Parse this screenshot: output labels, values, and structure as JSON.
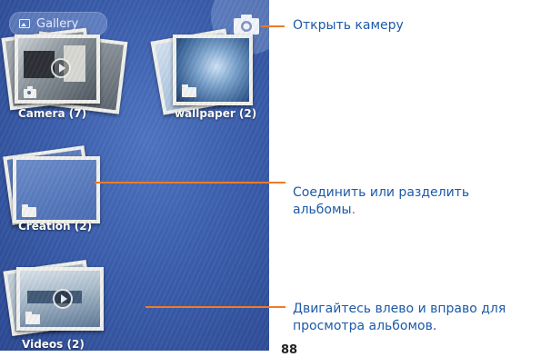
{
  "gallery": {
    "title": "Gallery"
  },
  "albums": [
    {
      "name": "Camera (7)"
    },
    {
      "name": "wallpaper (2)"
    },
    {
      "name": "Creation (2)"
    },
    {
      "name": "Videos (2)"
    }
  ],
  "callouts": {
    "camera": "Открыть камеру",
    "merge_line1": "Соединить или разделить",
    "merge_line2": "альбомы",
    "merge_dot": ".",
    "browse_line1": "Двигайтесь влево и вправо для",
    "browse_line2": "просмотра альбомов."
  },
  "page_number": "88",
  "colors": {
    "accent_line": "#ee7b28",
    "callout_text": "#1c5aa8",
    "phone_bg": "#3c5fae"
  }
}
